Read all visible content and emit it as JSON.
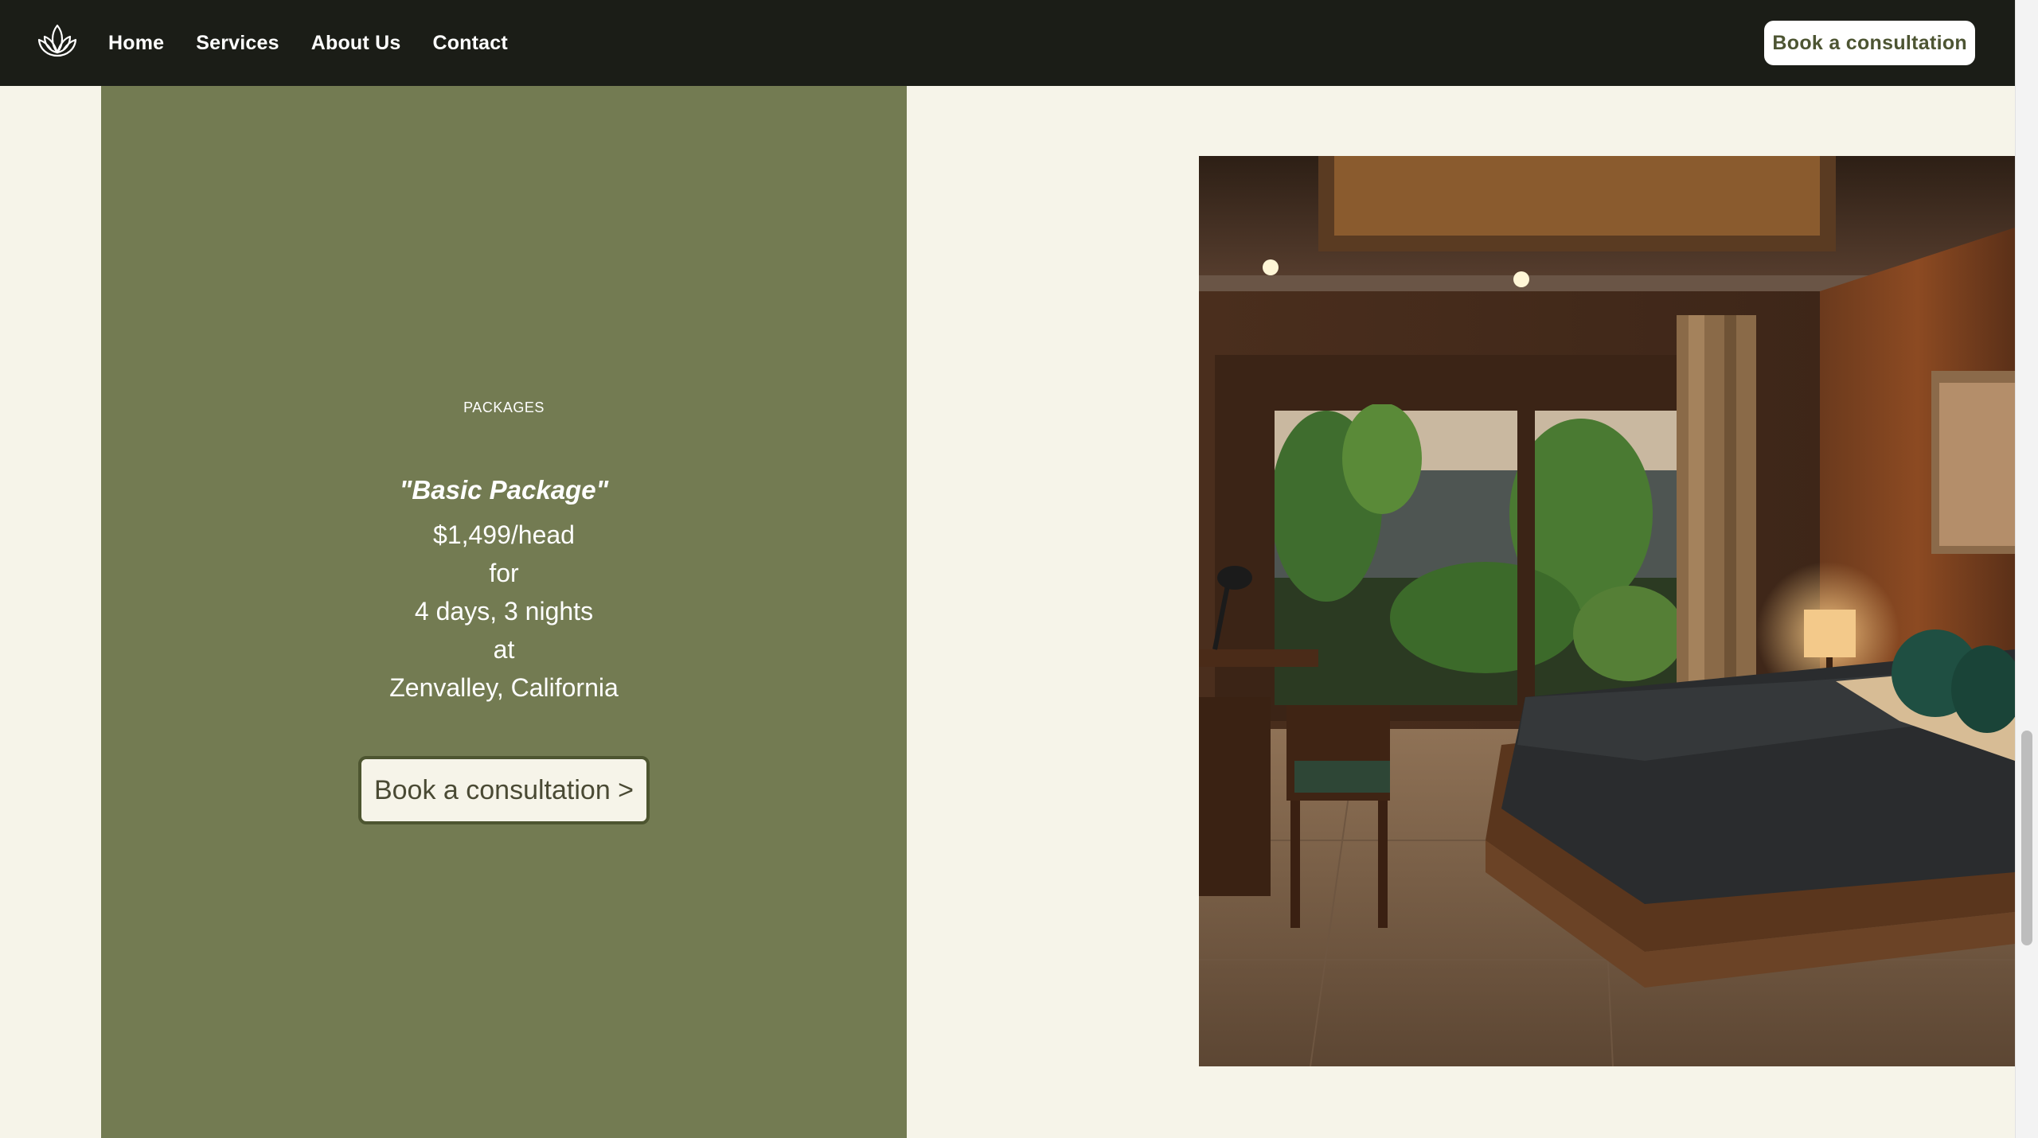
{
  "header": {
    "logo_icon": "lotus-icon",
    "nav": [
      {
        "label": "Home"
      },
      {
        "label": "Services"
      },
      {
        "label": "About Us"
      },
      {
        "label": "Contact"
      }
    ],
    "cta_label": "Book a consultation"
  },
  "package": {
    "eyebrow": "PACKAGES",
    "title": "\"Basic Package\"",
    "lines": [
      "$1,499/head",
      "for",
      "4 days, 3 nights",
      "at",
      "Zenvalley, California"
    ],
    "cta_label": "Book a consultation >"
  },
  "colors": {
    "header_bg": "#1b1d17",
    "panel_bg": "#737b52",
    "page_bg": "#f6f4e9",
    "accent_text": "#4d5533"
  }
}
